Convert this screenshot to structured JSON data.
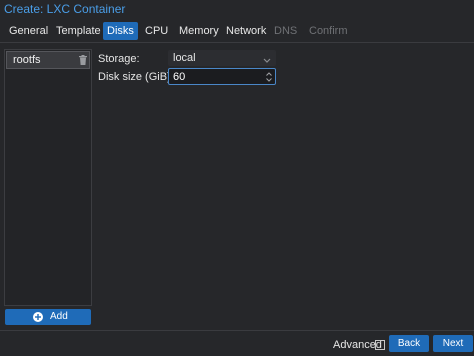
{
  "window": {
    "title": "Create: LXC Container"
  },
  "tabs": [
    {
      "label": "General",
      "state": "normal"
    },
    {
      "label": "Template",
      "state": "normal"
    },
    {
      "label": "Disks",
      "state": "active"
    },
    {
      "label": "CPU",
      "state": "normal"
    },
    {
      "label": "Memory",
      "state": "normal"
    },
    {
      "label": "Network",
      "state": "normal"
    },
    {
      "label": "DNS",
      "state": "disabled"
    },
    {
      "label": "Confirm",
      "state": "disabled"
    }
  ],
  "disks": {
    "items": [
      {
        "label": "rootfs",
        "icon": "trash-icon"
      }
    ],
    "add_label": "Add",
    "add_icon": "plus-circle-icon"
  },
  "form": {
    "storage_label": "Storage:",
    "storage_value": "local",
    "disk_size_label": "Disk size (GiB):",
    "disk_size_value": "60"
  },
  "footer": {
    "advanced_label": "Advanced",
    "advanced_checked": false,
    "back_label": "Back",
    "next_label": "Next"
  },
  "colors": {
    "accent": "#1f6bb8",
    "title": "#4a9ee8",
    "background": "#26272a"
  }
}
